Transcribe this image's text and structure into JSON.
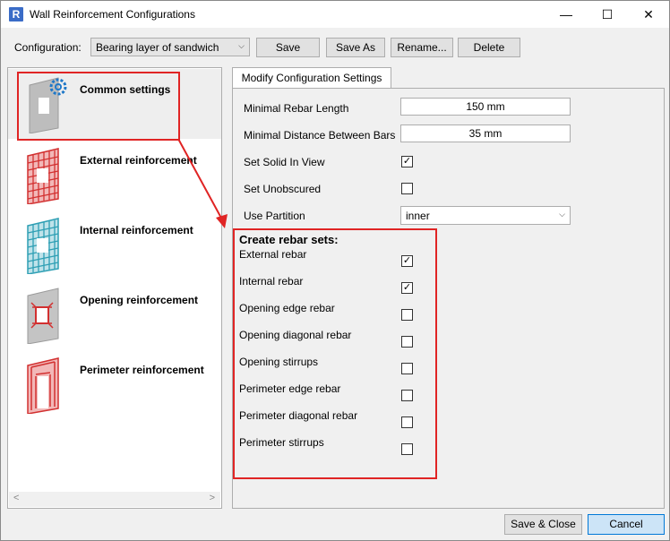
{
  "window": {
    "title": "Wall Reinforcement Configurations",
    "app_icon_letter": "R",
    "minimize_glyph": "—",
    "maximize_glyph": "☐",
    "close_glyph": "✕"
  },
  "toolbar": {
    "config_label": "Configuration:",
    "config_value": "Bearing layer of sandwich",
    "save_label": "Save",
    "save_as_label": "Save As",
    "rename_label": "Rename...",
    "delete_label": "Delete"
  },
  "sidebar": {
    "items": [
      {
        "label": "Common settings",
        "icon": "wall-gear-icon",
        "selected": true
      },
      {
        "label": "External reinforcement",
        "icon": "red-mesh-icon"
      },
      {
        "label": "Internal reinforcement",
        "icon": "blue-mesh-icon"
      },
      {
        "label": "Opening reinforcement",
        "icon": "opening-rebar-icon"
      },
      {
        "label": "Perimeter reinforcement",
        "icon": "perimeter-rebar-icon"
      }
    ],
    "scroll_left": "<",
    "scroll_right": ">"
  },
  "tab": {
    "label": "Modify Configuration Settings"
  },
  "settings": {
    "min_rebar_length_label": "Minimal Rebar Length",
    "min_rebar_length_value": "150 mm",
    "min_distance_label": "Minimal Distance Between Bars",
    "min_distance_value": "35 mm",
    "solid_in_view_label": "Set Solid In View",
    "solid_in_view_checked": true,
    "unobscured_label": "Set Unobscured",
    "unobscured_checked": false,
    "use_partition_label": "Use Partition",
    "use_partition_value": "inner"
  },
  "rebar_sets": {
    "title": "Create rebar sets:",
    "items": [
      {
        "label": "External rebar",
        "checked": true
      },
      {
        "label": "Internal rebar",
        "checked": true
      },
      {
        "label": "Opening edge rebar",
        "checked": false
      },
      {
        "label": "Opening diagonal rebar",
        "checked": false
      },
      {
        "label": "Opening stirrups",
        "checked": false
      },
      {
        "label": "Perimeter edge rebar",
        "checked": false
      },
      {
        "label": "Perimeter diagonal rebar",
        "checked": false
      },
      {
        "label": "Perimeter stirrups",
        "checked": false
      }
    ]
  },
  "footer": {
    "save_close_label": "Save & Close",
    "cancel_label": "Cancel"
  },
  "colors": {
    "highlight": "#e02424",
    "accent": "#0078d7"
  },
  "check_glyph": "✓"
}
